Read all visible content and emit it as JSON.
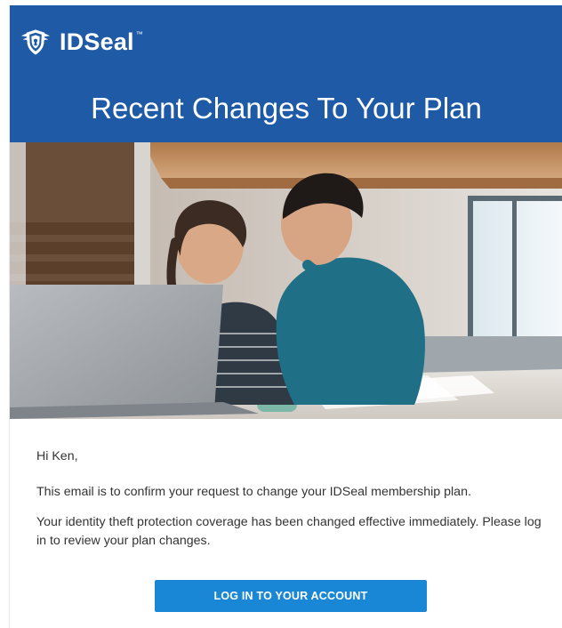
{
  "header": {
    "brand_name": "IDSeal",
    "brand_mark": "™",
    "title": "Recent Changes To Your Plan",
    "background": "#1f5aa6",
    "logo_icon": "shield-eagle-icon"
  },
  "hero": {
    "description_icon": "hero-photo"
  },
  "body": {
    "greeting": "Hi Ken,",
    "paragraph_1": "This email is to confirm your request to change your IDSeal membership plan.",
    "paragraph_2": "Your identity theft protection coverage has been changed effective immediately. Please log in to review your plan changes."
  },
  "cta": {
    "label": "LOG IN TO YOUR ACCOUNT",
    "color": "#1a87d6"
  }
}
